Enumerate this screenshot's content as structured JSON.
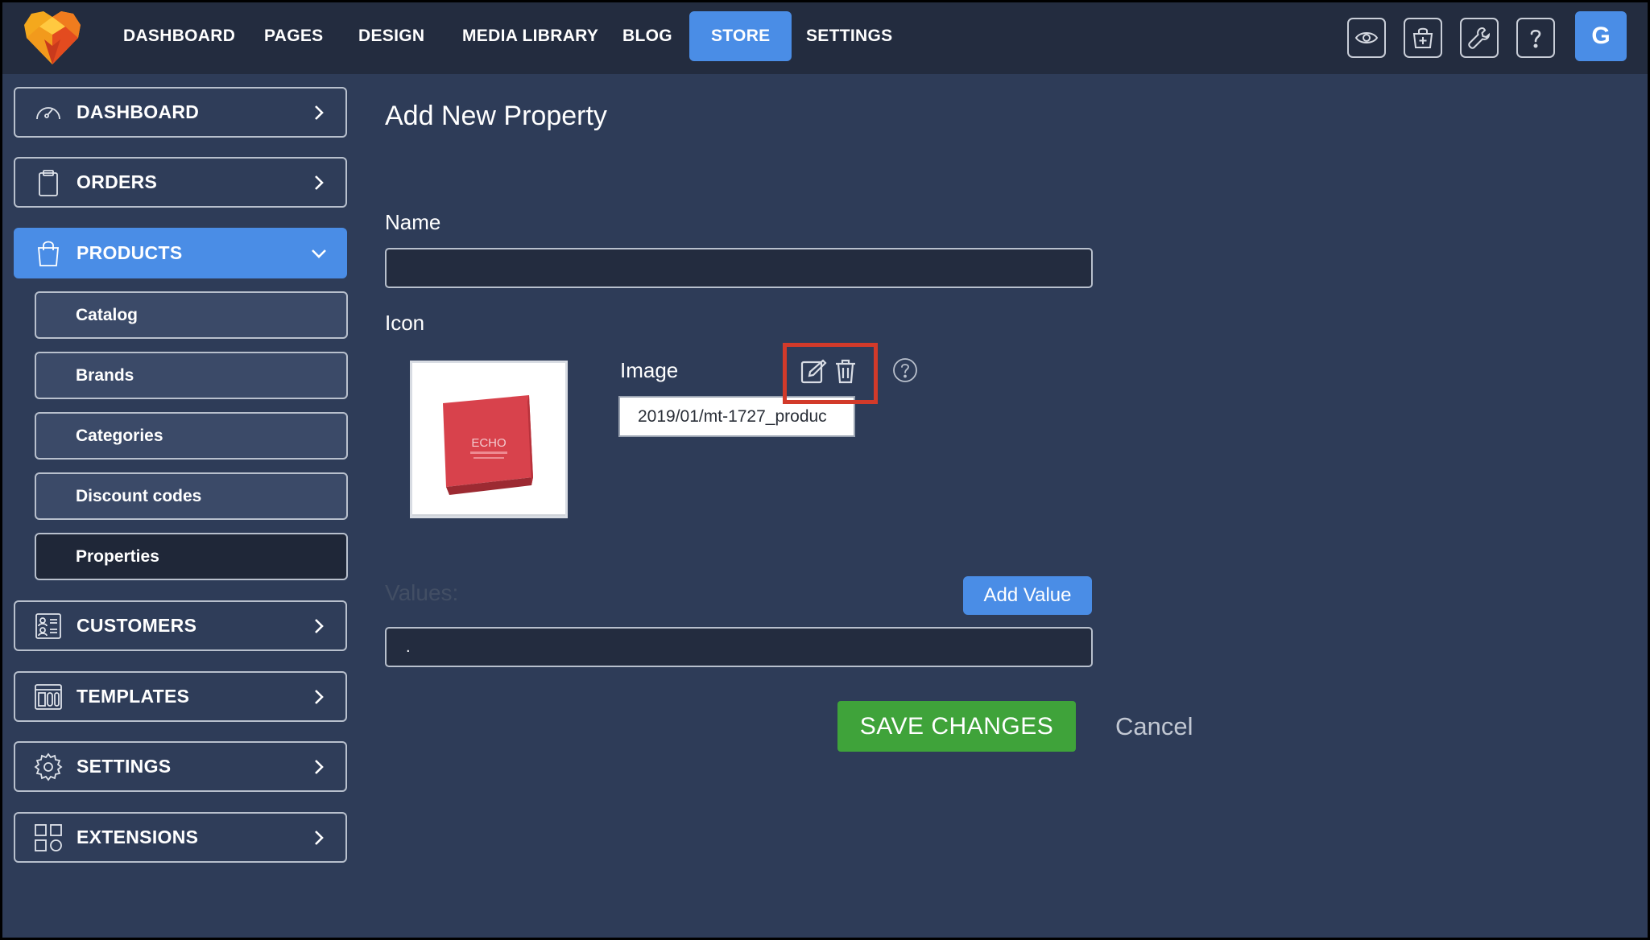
{
  "topnav": {
    "items": [
      {
        "label": "DASHBOARD"
      },
      {
        "label": "PAGES"
      },
      {
        "label": "DESIGN"
      },
      {
        "label": "MEDIA LIBRARY"
      },
      {
        "label": "BLOG"
      },
      {
        "label": "STORE",
        "active": true
      },
      {
        "label": "SETTINGS"
      }
    ],
    "icons": [
      "eye-icon",
      "shopping-basket-add-icon",
      "wrench-icon",
      "help-icon"
    ],
    "avatar_letter": "G"
  },
  "sidebar": {
    "items": [
      {
        "label": "DASHBOARD",
        "icon": "speedometer-icon"
      },
      {
        "label": "ORDERS",
        "icon": "clipboard-icon"
      },
      {
        "label": "PRODUCTS",
        "icon": "shopping-bag-icon",
        "expanded": true
      },
      {
        "label": "CUSTOMERS",
        "icon": "contact-list-icon"
      },
      {
        "label": "TEMPLATES",
        "icon": "template-layout-icon"
      },
      {
        "label": "SETTINGS",
        "icon": "gear-icon"
      },
      {
        "label": "EXTENSIONS",
        "icon": "apps-grid-icon"
      }
    ],
    "products_sub": [
      {
        "label": "Catalog"
      },
      {
        "label": "Brands"
      },
      {
        "label": "Categories"
      },
      {
        "label": "Discount codes"
      },
      {
        "label": "Properties",
        "active": true
      }
    ]
  },
  "main": {
    "title": "Add New Property",
    "name_label": "Name",
    "name_value": "",
    "icon_label": "Icon",
    "image_label": "Image",
    "image_path": "2019/01/mt-1727_produc",
    "image_product_text": "ECHO",
    "values_label": "Values:",
    "add_value_label": "Add Value",
    "values_field_value": ".",
    "save_label": "SAVE CHANGES",
    "cancel_label": "Cancel"
  },
  "colors": {
    "accent": "#4a8de6",
    "save_green": "#3fa33a",
    "background": "#2e3c58",
    "topbar": "#232c3f",
    "highlight": "#d23a2a"
  }
}
